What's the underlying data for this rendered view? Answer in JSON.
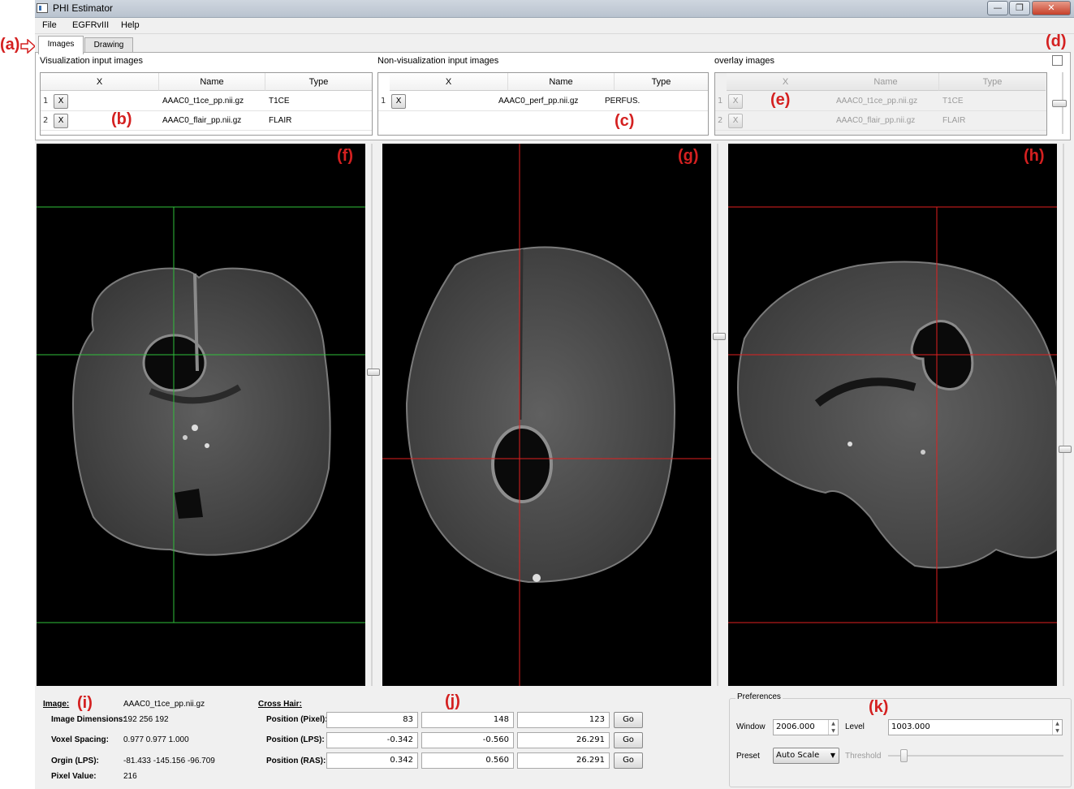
{
  "window": {
    "title": "PHI Estimator",
    "minimize": "—",
    "maximize": "❐",
    "close": "✕"
  },
  "menu": [
    "File",
    "EGFRvIII",
    "Help"
  ],
  "tabs": [
    "Images",
    "Drawing"
  ],
  "annotations": {
    "a": "(a)",
    "b": "(b)",
    "c": "(c)",
    "d": "(d)",
    "e": "(e)",
    "f": "(f)",
    "g": "(g)",
    "h": "(h)",
    "i": "(i)",
    "j": "(j)",
    "k": "(k)"
  },
  "groups": {
    "vis": {
      "title": "Visualization input images",
      "headers": [
        "X",
        "Name",
        "Type"
      ],
      "rows": [
        {
          "num": "1",
          "btn": "X",
          "name": "AAAC0_t1ce_pp.nii.gz",
          "type": "T1CE"
        },
        {
          "num": "2",
          "btn": "X",
          "name": "AAAC0_flair_pp.nii.gz",
          "type": "FLAIR"
        }
      ]
    },
    "nonvis": {
      "title": "Non-visualization input images",
      "headers": [
        "X",
        "Name",
        "Type"
      ],
      "rows": [
        {
          "num": "1",
          "btn": "X",
          "name": "AAAC0_perf_pp.nii.gz",
          "type": "PERFUS."
        }
      ]
    },
    "overlay": {
      "title": "overlay images",
      "headers": [
        "X",
        "Name",
        "Type"
      ],
      "rows": [
        {
          "num": "1",
          "btn": "X",
          "name": "AAAC0_t1ce_pp.nii.gz",
          "type": "T1CE"
        },
        {
          "num": "2",
          "btn": "X",
          "name": "AAAC0_flair_pp.nii.gz",
          "type": "FLAIR"
        }
      ]
    }
  },
  "image_info": {
    "image_label": "Image:",
    "image_value": "AAAC0_t1ce_pp.nii.gz",
    "dims_label": "Image Dimensions:",
    "dims_value": "192  256  192",
    "spacing_label": "Voxel Spacing:",
    "spacing_value": "0.977  0.977  1.000",
    "origin_label": "Orgin (LPS):",
    "origin_value": "-81.433  -145.156  -96.709",
    "pixel_label": "Pixel Value:",
    "pixel_value": "216"
  },
  "crosshair": {
    "title": "Cross Hair:",
    "rows": [
      {
        "label": "Position (Pixel):",
        "v1": "83",
        "v2": "148",
        "v3": "123",
        "go": "Go"
      },
      {
        "label": "Position (LPS):",
        "v1": "-0.342",
        "v2": "-0.560",
        "v3": "26.291",
        "go": "Go"
      },
      {
        "label": "Position (RAS):",
        "v1": "0.342",
        "v2": "0.560",
        "v3": "26.291",
        "go": "Go"
      }
    ]
  },
  "preferences": {
    "title": "Preferences",
    "window_label": "Window",
    "window_value": "2006.000",
    "level_label": "Level",
    "level_value": "1003.000",
    "preset_label": "Preset",
    "preset_value": "Auto Scale",
    "threshold_label": "Threshold"
  },
  "colors": {
    "crosshair_coronal": "#2fbf3a",
    "crosshair_axial": "#e02020",
    "crosshair_sagittal": "#e02020",
    "annotation": "#d42020"
  }
}
